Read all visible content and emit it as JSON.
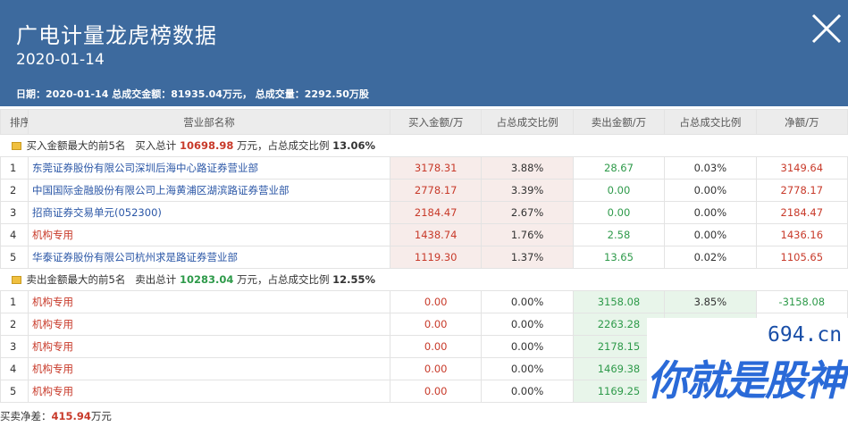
{
  "header": {
    "title": "广电计量龙虎榜数据",
    "date": "2020-01-14",
    "summary": "日期：2020-01-14 总成交金额：81935.04万元， 总成交量：2292.50万股"
  },
  "columns": [
    "排序",
    "营业部名称",
    "买入金额/万",
    "占总成交比例",
    "卖出金额/万",
    "占总成交比例",
    "净额/万"
  ],
  "buy_section": {
    "label": "买入金额最大的前5名",
    "total_label": "买入总计",
    "total_value": "10698.98",
    "unit_text": "万元，占总成交比例",
    "ratio": "13.06%",
    "rows": [
      {
        "rank": "1",
        "name": "东莞证券股份有限公司深圳后海中心路证券营业部",
        "buy": "3178.31",
        "buy_pct": "3.88%",
        "sell": "28.67",
        "sell_pct": "0.03%",
        "net": "3149.64"
      },
      {
        "rank": "2",
        "name": "中国国际金融股份有限公司上海黄浦区湖滨路证券营业部",
        "buy": "2778.17",
        "buy_pct": "3.39%",
        "sell": "0.00",
        "sell_pct": "0.00%",
        "net": "2778.17"
      },
      {
        "rank": "3",
        "name": "招商证券交易单元(052300)",
        "buy": "2184.47",
        "buy_pct": "2.67%",
        "sell": "0.00",
        "sell_pct": "0.00%",
        "net": "2184.47"
      },
      {
        "rank": "4",
        "name": "机构专用",
        "buy": "1438.74",
        "buy_pct": "1.76%",
        "sell": "2.58",
        "sell_pct": "0.00%",
        "net": "1436.16"
      },
      {
        "rank": "5",
        "name": "华泰证券股份有限公司杭州求是路证券营业部",
        "buy": "1119.30",
        "buy_pct": "1.37%",
        "sell": "13.65",
        "sell_pct": "0.02%",
        "net": "1105.65"
      }
    ]
  },
  "sell_section": {
    "label": "卖出金额最大的前5名",
    "total_label": "卖出总计",
    "total_value": "10283.04",
    "unit_text": "万元，占总成交比例",
    "ratio": "12.55%",
    "rows": [
      {
        "rank": "1",
        "name": "机构专用",
        "buy": "0.00",
        "buy_pct": "0.00%",
        "sell": "3158.08",
        "sell_pct": "3.85%",
        "net": "-3158.08"
      },
      {
        "rank": "2",
        "name": "机构专用",
        "buy": "0.00",
        "buy_pct": "0.00%",
        "sell": "2263.28",
        "sell_pct": "",
        "net": ""
      },
      {
        "rank": "3",
        "name": "机构专用",
        "buy": "0.00",
        "buy_pct": "0.00%",
        "sell": "2178.15",
        "sell_pct": "",
        "net": ""
      },
      {
        "rank": "4",
        "name": "机构专用",
        "buy": "0.00",
        "buy_pct": "0.00%",
        "sell": "1469.38",
        "sell_pct": "",
        "net": ""
      },
      {
        "rank": "5",
        "name": "机构专用",
        "buy": "0.00",
        "buy_pct": "0.00%",
        "sell": "1169.25",
        "sell_pct": "",
        "net": ""
      }
    ]
  },
  "footer": {
    "label": "买卖净差：",
    "value": "415.94",
    "unit": "万元"
  },
  "watermark": {
    "url": "694.cn",
    "text": "你就是股神"
  },
  "colors": {
    "header_bg": "#3d6a9e",
    "buy_red": "#c83a2a",
    "sell_green": "#2e9a4a",
    "link_blue": "#2a56a6"
  },
  "icons": {
    "close": "close-icon",
    "section": "folder-icon"
  }
}
